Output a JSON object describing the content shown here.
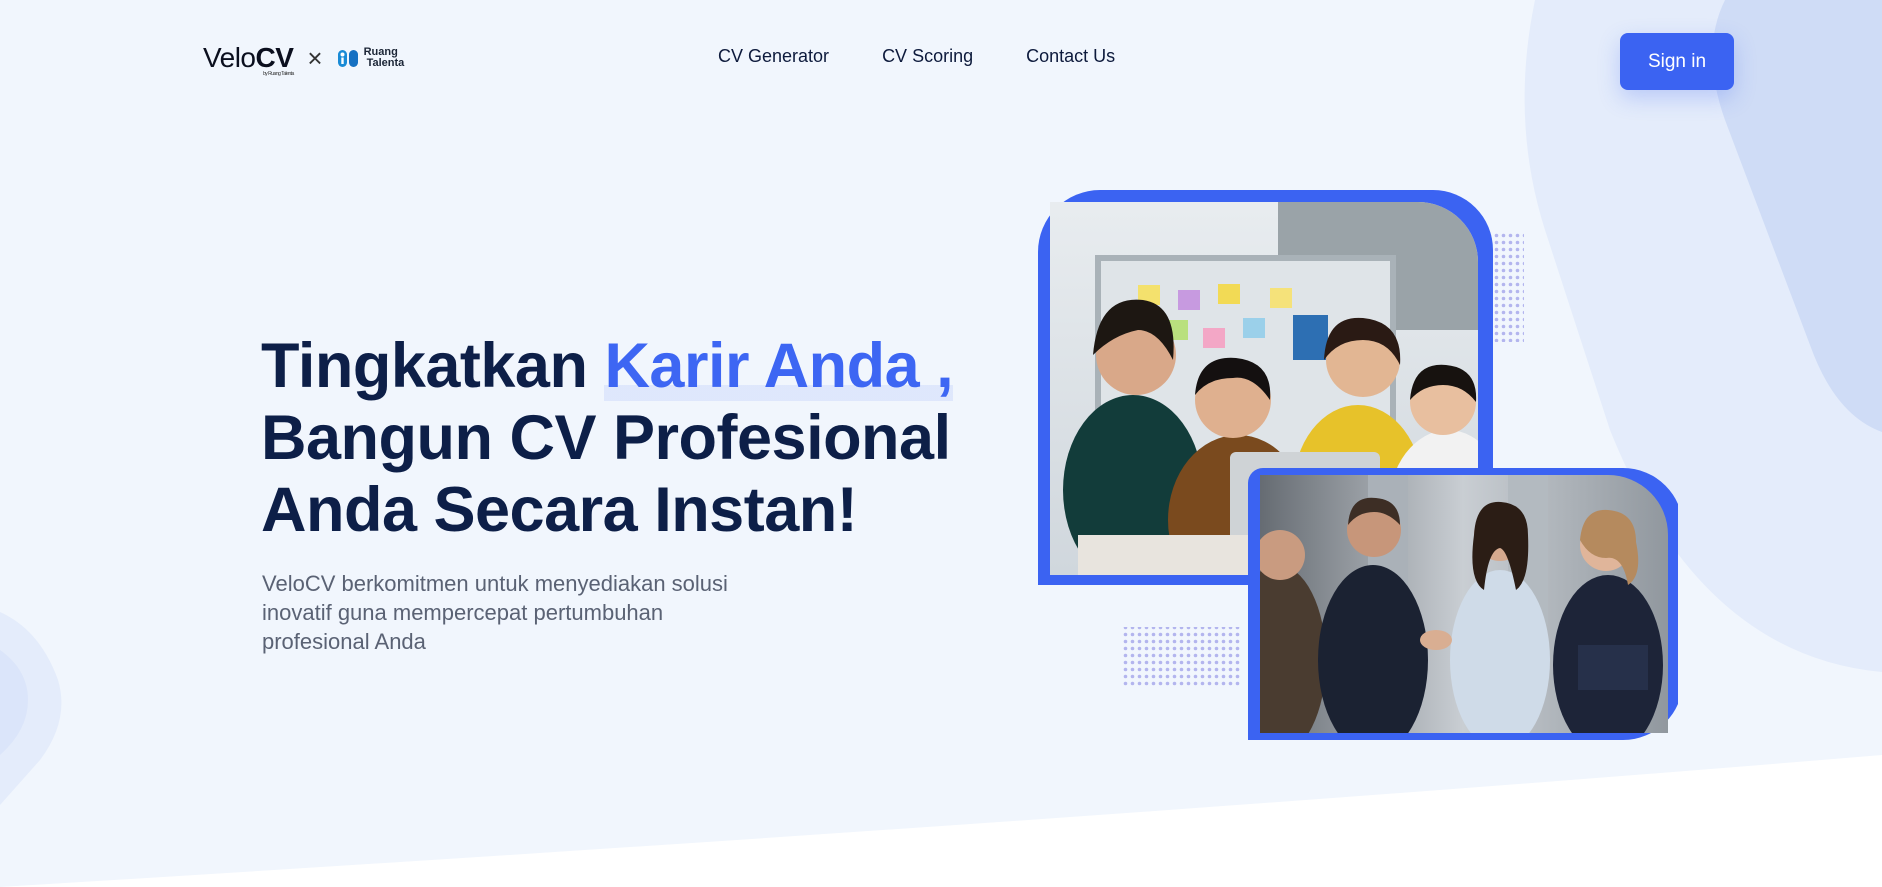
{
  "brand": {
    "logo_text_light": "Velo",
    "logo_text_bold": "CV",
    "logo_subtext": "by Ruang Talenta",
    "partner_separator": "×",
    "partner_line1": "Ruang",
    "partner_line2": "Talenta"
  },
  "nav": {
    "items": [
      {
        "label": "CV Generator"
      },
      {
        "label": "CV Scoring"
      },
      {
        "label": "Contact Us"
      }
    ],
    "signin_label": "Sign in"
  },
  "hero": {
    "headline_part1": "Tingkatkan ",
    "headline_accent": "Karir Anda ,",
    "headline_line2": "Bangun CV Profesional",
    "headline_line3": "Anda Secara Instan!",
    "description": "VeloCV berkomitmen untuk menyediakan solusi inovatif guna mempercepat pertumbuhan profesional Anda"
  },
  "colors": {
    "primary": "#3b63f2",
    "headline": "#0d1f48",
    "hero_background": "#f1f6fd",
    "decor_light": "#e2ebfb",
    "decor_mid": "#cfdcf6",
    "dots": "#b3b5ee"
  },
  "icons": {
    "partner_logo": "ruang-talenta-logo",
    "separator": "times-icon"
  }
}
